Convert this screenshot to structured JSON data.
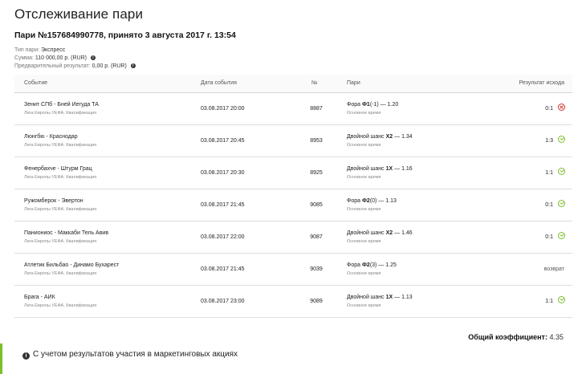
{
  "page": {
    "title": "Отслеживание пари",
    "bet_heading": "Пари №157684990778, принято 3 августа 2017 г. 13:54"
  },
  "meta": {
    "type_label": "Тип пари:",
    "type_value": "Экспресс",
    "sum_label": "Сумма:",
    "sum_value": "110 000,00 р. (RUR)",
    "prelim_label": "Предварительный результат:",
    "prelim_value": "0,00 р. (RUR)"
  },
  "table": {
    "headers": {
      "event": "Событие",
      "date": "Дата события",
      "num": "№",
      "bet": "Пари",
      "result": "Результат исхода"
    },
    "rows": [
      {
        "event": "Зенит СПб - Бней Иегуда ТА",
        "league": "Лига Европы УЕФА. Квалификация",
        "date": "03.08.2017 20:00",
        "num": "8887",
        "bet_prefix": "Фора ",
        "bet_bold": "Ф1",
        "bet_suffix": "(-1) — 1.20",
        "bet_sub": "Основное время",
        "score": "0:1",
        "status": "lose"
      },
      {
        "event": "Люнгбю - Краснодар",
        "league": "Лига Европы УЕФА. Квалификация",
        "date": "03.08.2017 20:45",
        "num": "8953",
        "bet_prefix": "Двойной шанс ",
        "bet_bold": "X2",
        "bet_suffix": " — 1.34",
        "bet_sub": "Основное время",
        "score": "1:3",
        "status": "win"
      },
      {
        "event": "Фенербахче - Штурм Грац",
        "league": "Лига Европы УЕФА. Квалификация",
        "date": "03.08.2017 20:30",
        "num": "8925",
        "bet_prefix": "Двойной шанс ",
        "bet_bold": "1X",
        "bet_suffix": " — 1.16",
        "bet_sub": "Основное время",
        "score": "1:1",
        "status": "win"
      },
      {
        "event": "Ружомберок - Эвертон",
        "league": "Лига Европы УЕФА. Квалификация",
        "date": "03.08.2017 21:45",
        "num": "9085",
        "bet_prefix": "Фора ",
        "bet_bold": "Ф2",
        "bet_suffix": "(0) — 1.13",
        "bet_sub": "Основное время",
        "score": "0:1",
        "status": "win"
      },
      {
        "event": "Паниониос - Маккаби Тель Авив",
        "league": "Лига Европы УЕФА. Квалификация",
        "date": "03.08.2017 22:00",
        "num": "9087",
        "bet_prefix": "Двойной шанс ",
        "bet_bold": "X2",
        "bet_suffix": " — 1.46",
        "bet_sub": "Основное время",
        "score": "0:1",
        "status": "win"
      },
      {
        "event": "Атлетик Бильбао - Динамо Бухарест",
        "league": "Лига Европы УЕФА. Квалификация",
        "date": "03.08.2017 21:45",
        "num": "9039",
        "bet_prefix": "Фора ",
        "bet_bold": "Ф2",
        "bet_suffix": "(3) — 1.25",
        "bet_sub": "Основное время",
        "score": "возврат",
        "status": "refund"
      },
      {
        "event": "Брага - АИК",
        "league": "Лига Европы УЕФА. Квалификация",
        "date": "03.08.2017 23:00",
        "num": "9089",
        "bet_prefix": "Двойной шанс ",
        "bet_bold": "1X",
        "bet_suffix": " — 1.13",
        "bet_sub": "Основное время",
        "score": "1:1",
        "status": "win"
      }
    ]
  },
  "total": {
    "label": "Общий коэффициент:",
    "value": "4.35"
  },
  "footer": {
    "text": "С учетом результатов участия в маркетинговых акциях"
  },
  "colors": {
    "win": "#7bbf2a",
    "lose": "#d0342c",
    "accent_bar": "#7bbf2a"
  }
}
